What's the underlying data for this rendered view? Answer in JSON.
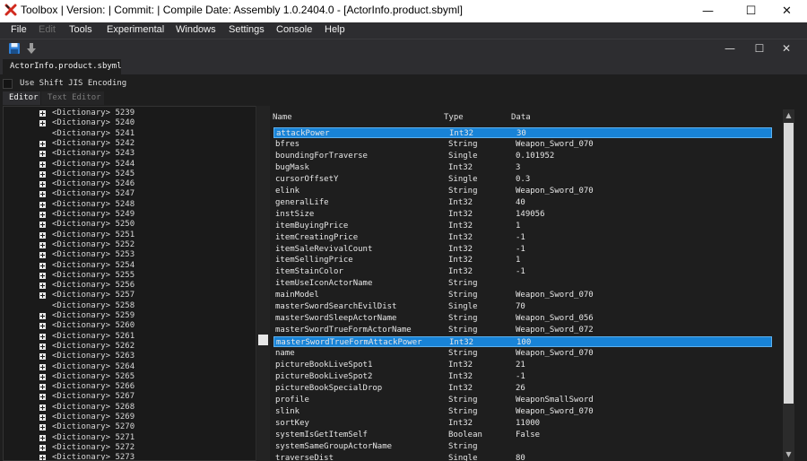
{
  "window": {
    "title": "Toolbox | Version:  | Commit:  | Compile Date:  Assembly 1.0.2404.0 - [ActorInfo.product.sbyml]",
    "minimize": "—",
    "maximize": "☐",
    "close": "✕"
  },
  "menu": {
    "file": "File",
    "edit": "Edit",
    "tools": "Tools",
    "experimental": "Experimental",
    "windows": "Windows",
    "settings": "Settings",
    "console": "Console",
    "help": "Help"
  },
  "toolbar": {
    "save_icon": "save-icon",
    "import_icon": "download-arrow-icon",
    "mdi_minimize": "—",
    "mdi_maximize": "☐",
    "mdi_close": "✕"
  },
  "document": {
    "tab": "ActorInfo.product.sbyml",
    "shift_jis_label": "Use Shift JIS Encoding",
    "shift_jis_checked": false,
    "subtab_editor": "Editor",
    "subtab_text": "Text Editor"
  },
  "tree": {
    "items": [
      {
        "label": "<Dictionary> 5239",
        "expandable": true
      },
      {
        "label": "<Dictionary> 5240",
        "expandable": true
      },
      {
        "label": "<Dictionary> 5241",
        "expandable": false
      },
      {
        "label": "<Dictionary> 5242",
        "expandable": true
      },
      {
        "label": "<Dictionary> 5243",
        "expandable": true
      },
      {
        "label": "<Dictionary> 5244",
        "expandable": true
      },
      {
        "label": "<Dictionary> 5245",
        "expandable": true
      },
      {
        "label": "<Dictionary> 5246",
        "expandable": true
      },
      {
        "label": "<Dictionary> 5247",
        "expandable": true
      },
      {
        "label": "<Dictionary> 5248",
        "expandable": true
      },
      {
        "label": "<Dictionary> 5249",
        "expandable": true
      },
      {
        "label": "<Dictionary> 5250",
        "expandable": true
      },
      {
        "label": "<Dictionary> 5251",
        "expandable": true
      },
      {
        "label": "<Dictionary> 5252",
        "expandable": true
      },
      {
        "label": "<Dictionary> 5253",
        "expandable": true
      },
      {
        "label": "<Dictionary> 5254",
        "expandable": true
      },
      {
        "label": "<Dictionary> 5255",
        "expandable": true
      },
      {
        "label": "<Dictionary> 5256",
        "expandable": true
      },
      {
        "label": "<Dictionary> 5257",
        "expandable": true
      },
      {
        "label": "<Dictionary> 5258",
        "expandable": false
      },
      {
        "label": "<Dictionary> 5259",
        "expandable": true
      },
      {
        "label": "<Dictionary> 5260",
        "expandable": true
      },
      {
        "label": "<Dictionary> 5261",
        "expandable": true
      },
      {
        "label": "<Dictionary> 5262",
        "expandable": true
      },
      {
        "label": "<Dictionary> 5263",
        "expandable": true
      },
      {
        "label": "<Dictionary> 5264",
        "expandable": true
      },
      {
        "label": "<Dictionary> 5265",
        "expandable": true
      },
      {
        "label": "<Dictionary> 5266",
        "expandable": true
      },
      {
        "label": "<Dictionary> 5267",
        "expandable": true
      },
      {
        "label": "<Dictionary> 5268",
        "expandable": true
      },
      {
        "label": "<Dictionary> 5269",
        "expandable": true
      },
      {
        "label": "<Dictionary> 5270",
        "expandable": true
      },
      {
        "label": "<Dictionary> 5271",
        "expandable": true
      },
      {
        "label": "<Dictionary> 5272",
        "expandable": true
      },
      {
        "label": "<Dictionary> 5273",
        "expandable": true
      }
    ]
  },
  "grid": {
    "columns": [
      "Name",
      "Type",
      "Data"
    ],
    "rows": [
      {
        "name": "attackPower",
        "type": "Int32",
        "data": "30",
        "selected": true
      },
      {
        "name": "bfres",
        "type": "String",
        "data": "Weapon_Sword_070",
        "selected": false
      },
      {
        "name": "boundingForTraverse",
        "type": "Single",
        "data": "0.101952",
        "selected": false
      },
      {
        "name": "bugMask",
        "type": "Int32",
        "data": "3",
        "selected": false
      },
      {
        "name": "cursorOffsetY",
        "type": "Single",
        "data": "0.3",
        "selected": false
      },
      {
        "name": "elink",
        "type": "String",
        "data": "Weapon_Sword_070",
        "selected": false
      },
      {
        "name": "generalLife",
        "type": "Int32",
        "data": "40",
        "selected": false
      },
      {
        "name": "instSize",
        "type": "Int32",
        "data": "149056",
        "selected": false
      },
      {
        "name": "itemBuyingPrice",
        "type": "Int32",
        "data": "1",
        "selected": false
      },
      {
        "name": "itemCreatingPrice",
        "type": "Int32",
        "data": "-1",
        "selected": false
      },
      {
        "name": "itemSaleRevivalCount",
        "type": "Int32",
        "data": "-1",
        "selected": false
      },
      {
        "name": "itemSellingPrice",
        "type": "Int32",
        "data": "1",
        "selected": false
      },
      {
        "name": "itemStainColor",
        "type": "Int32",
        "data": "-1",
        "selected": false
      },
      {
        "name": "itemUseIconActorName",
        "type": "String",
        "data": "",
        "selected": false
      },
      {
        "name": "mainModel",
        "type": "String",
        "data": "Weapon_Sword_070",
        "selected": false
      },
      {
        "name": "masterSwordSearchEvilDist",
        "type": "Single",
        "data": "70",
        "selected": false
      },
      {
        "name": "masterSwordSleepActorName",
        "type": "String",
        "data": "Weapon_Sword_056",
        "selected": false
      },
      {
        "name": "masterSwordTrueFormActorName",
        "type": "String",
        "data": "Weapon_Sword_072",
        "selected": false
      },
      {
        "name": "masterSwordTrueFormAttackPower",
        "type": "Int32",
        "data": "100",
        "selected": true
      },
      {
        "name": "name",
        "type": "String",
        "data": "Weapon_Sword_070",
        "selected": false
      },
      {
        "name": "pictureBookLiveSpot1",
        "type": "Int32",
        "data": "21",
        "selected": false
      },
      {
        "name": "pictureBookLiveSpot2",
        "type": "Int32",
        "data": "-1",
        "selected": false
      },
      {
        "name": "pictureBookSpecialDrop",
        "type": "Int32",
        "data": "26",
        "selected": false
      },
      {
        "name": "profile",
        "type": "String",
        "data": "WeaponSmallSword",
        "selected": false
      },
      {
        "name": "slink",
        "type": "String",
        "data": "Weapon_Sword_070",
        "selected": false
      },
      {
        "name": "sortKey",
        "type": "Int32",
        "data": "11000",
        "selected": false
      },
      {
        "name": "systemIsGetItemSelf",
        "type": "Boolean",
        "data": "False",
        "selected": false
      },
      {
        "name": "systemSameGroupActorName",
        "type": "String",
        "data": "",
        "selected": false
      },
      {
        "name": "traverseDist",
        "type": "Single",
        "data": "80",
        "selected": false
      }
    ]
  },
  "colors": {
    "selection": "#1883d7",
    "background": "#1e1e1e",
    "menu_background": "#2d2d30"
  }
}
